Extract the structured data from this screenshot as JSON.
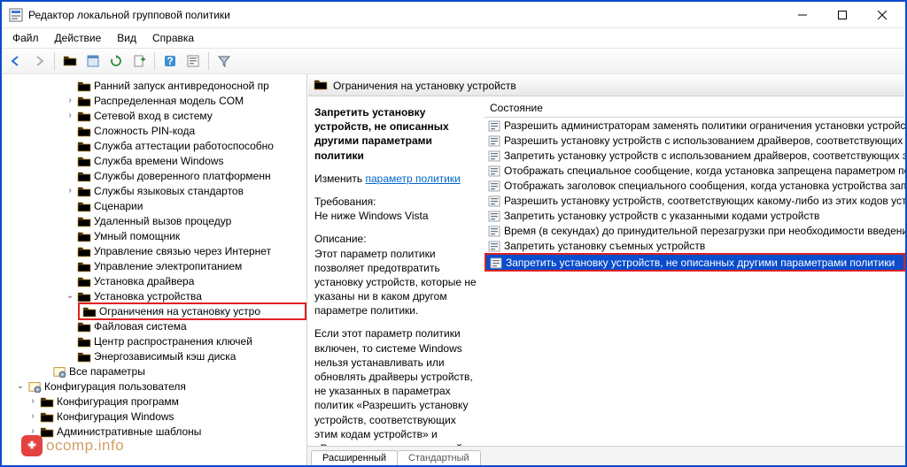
{
  "window": {
    "title": "Редактор локальной групповой политики"
  },
  "menu": {
    "file": "Файл",
    "action": "Действие",
    "view": "Вид",
    "help": "Справка"
  },
  "right_header": {
    "title": "Ограничения на установку устройств"
  },
  "list_header": {
    "col1": "Состояние"
  },
  "details": {
    "policy_name": "Запретить установку устройств, не описанных другими параметрами политики",
    "edit_label": "Изменить",
    "edit_link": "параметр политики",
    "req_label": "Требования:",
    "req_value": "Не ниже Windows Vista",
    "desc_label": "Описание:",
    "desc_p1": "Этот параметр политики позволяет предотвратить установку устройств, которые не указаны ни в каком другом параметре политики.",
    "desc_p2": "Если этот параметр политики включен, то системе Windows нельзя устанавливать или обновлять драйверы устройств, не указанных в параметрах политик «Разрешить установку устройств, соответствующих этим кодам устройств» и «Разрешить установку устройств для этих классов"
  },
  "tree": [
    {
      "indent": 5,
      "caret": "",
      "label": "Ранний запуск антивредоносной пр"
    },
    {
      "indent": 5,
      "caret": ">",
      "label": "Распределенная модель COM"
    },
    {
      "indent": 5,
      "caret": ">",
      "label": "Сетевой вход в систему"
    },
    {
      "indent": 5,
      "caret": "",
      "label": "Сложность PIN-кода"
    },
    {
      "indent": 5,
      "caret": "",
      "label": "Служба аттестации работоспособно"
    },
    {
      "indent": 5,
      "caret": "",
      "label": "Служба времени Windows"
    },
    {
      "indent": 5,
      "caret": "",
      "label": "Службы доверенного платформенн"
    },
    {
      "indent": 5,
      "caret": ">",
      "label": "Службы языковых стандартов"
    },
    {
      "indent": 5,
      "caret": "",
      "label": "Сценарии"
    },
    {
      "indent": 5,
      "caret": "",
      "label": "Удаленный вызов процедур"
    },
    {
      "indent": 5,
      "caret": "",
      "label": "Умный помощник"
    },
    {
      "indent": 5,
      "caret": "",
      "label": "Управление связью через Интернет"
    },
    {
      "indent": 5,
      "caret": "",
      "label": "Управление электропитанием"
    },
    {
      "indent": 5,
      "caret": "",
      "label": "Установка драйвера"
    },
    {
      "indent": 5,
      "caret": "v",
      "label": "Установка устройства"
    },
    {
      "indent": 6,
      "caret": "",
      "label": "Ограничения на установку устро",
      "highlight": true
    },
    {
      "indent": 5,
      "caret": "",
      "label": "Файловая система"
    },
    {
      "indent": 5,
      "caret": "",
      "label": "Центр распространения ключей"
    },
    {
      "indent": 5,
      "caret": "",
      "label": "Энергозависимый кэш диска"
    },
    {
      "indent": 3,
      "caret": "",
      "label": "Все параметры",
      "icon": "cog"
    },
    {
      "indent": 1,
      "caret": "v",
      "label": "Конфигурация пользователя",
      "icon": "cog"
    },
    {
      "indent": 2,
      "caret": ">",
      "label": "Конфигурация программ"
    },
    {
      "indent": 2,
      "caret": ">",
      "label": "Конфигурация Windows"
    },
    {
      "indent": 2,
      "caret": ">",
      "label": "Административные шаблоны"
    }
  ],
  "settings": [
    {
      "label": "Разрешить администраторам заменять политики ограничения установки устройств"
    },
    {
      "label": "Разрешить установку устройств с использованием драйверов, соответствующих этим к"
    },
    {
      "label": "Запретить установку устройств с использованием драйверов, соответствующих этим к"
    },
    {
      "label": "Отображать специальное сообщение, когда установка запрещена параметром полит"
    },
    {
      "label": "Отображать заголовок специального сообщения, когда установка устройства запреще"
    },
    {
      "label": "Разрешить установку устройств, соответствующих какому-либо из этих кодов устройс"
    },
    {
      "label": "Запретить установку устройств с указанными кодами устройств"
    },
    {
      "label": "Время (в секундах) до принудительной перезагрузки при необходимости введения пар"
    },
    {
      "label": "Запретить установку съемных устройств"
    },
    {
      "label": "Запретить установку устройств, не описанных другими параметрами политики",
      "highlight": true
    }
  ],
  "bottom_tabs": {
    "tab1": "Расширенный",
    "tab2": "Стандартный"
  },
  "watermark": {
    "text": "ocomp.info"
  }
}
